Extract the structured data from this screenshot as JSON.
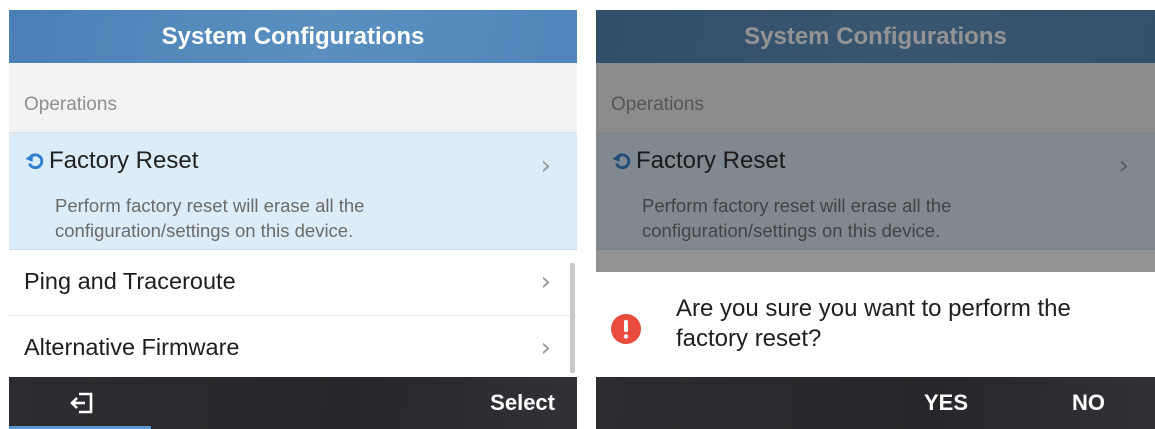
{
  "left_screen": {
    "title": "System Configurations",
    "section_label": "Operations",
    "items": [
      {
        "label": "Factory Reset",
        "description": "Perform factory reset will erase all the configuration/settings on this device.",
        "selected": true,
        "icon": "reset-icon"
      },
      {
        "label": "Ping and Traceroute"
      },
      {
        "label": "Alternative Firmware"
      }
    ],
    "softkeys": {
      "back_icon": "exit-icon",
      "select_label": "Select"
    }
  },
  "right_screen": {
    "title": "System Configurations",
    "section_label": "Operations",
    "item_label": "Factory Reset",
    "item_description": "Perform factory reset will erase all the configuration/settings on this device.",
    "dialog": {
      "icon": "alert-icon",
      "message": "Are you sure you want to perform the factory reset?",
      "yes_label": "YES",
      "no_label": "NO"
    }
  },
  "colors": {
    "title_bar": "#5a8fc0",
    "selected_row": "#dcecf8",
    "softkey_bar": "#27292c",
    "alert_red": "#e94b3c"
  }
}
